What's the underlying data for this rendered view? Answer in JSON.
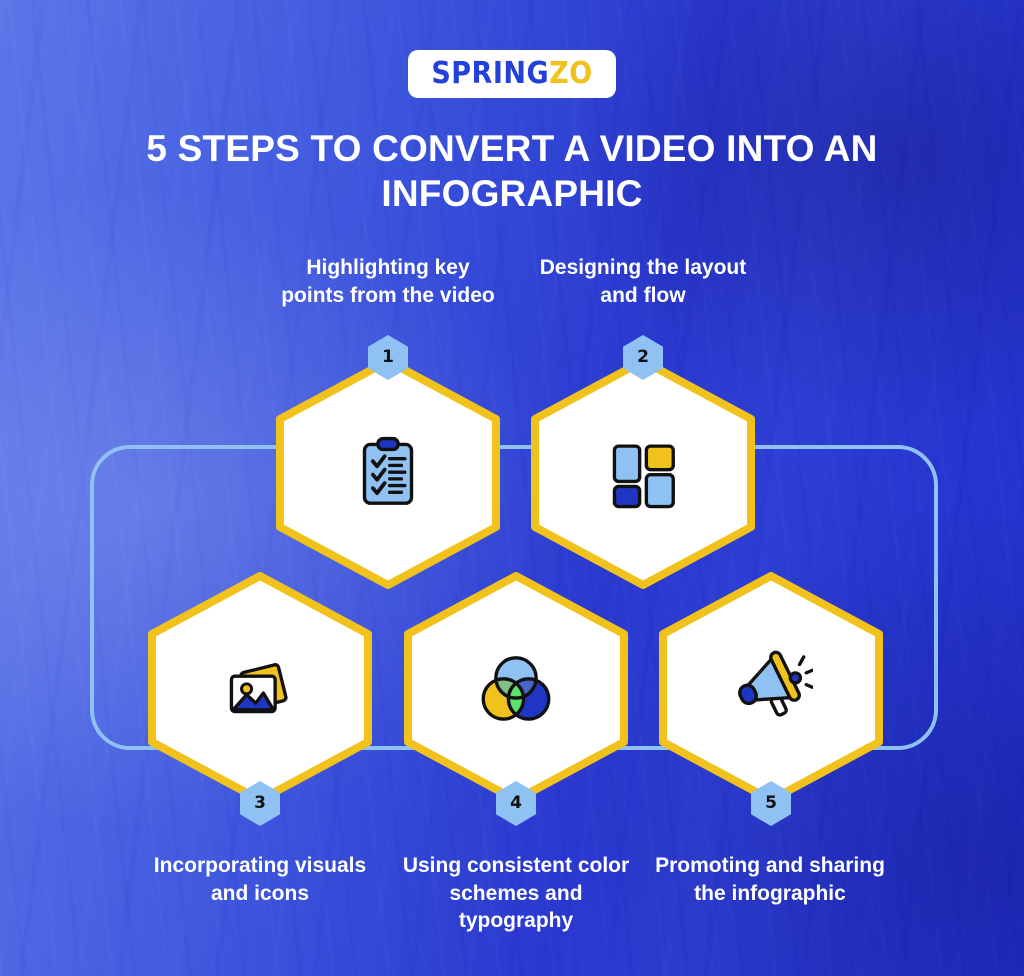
{
  "brand": {
    "logo_part1": "SPRING",
    "logo_part2": "ZO",
    "logo_blue": "#2341D8",
    "logo_yellow": "#F2C21C"
  },
  "header": {
    "title": "5 STEPS TO CONVERT A VIDEO INTO AN INFOGRAPHIC"
  },
  "theme": {
    "hex_border": "#F2C21C",
    "hex_fill": "#FFFFFF",
    "badge_fill": "#8FC2F2",
    "connector_stroke": "#8FC2F2",
    "background_blue_light": "#5C76E8",
    "background_blue_dark": "#2230CB",
    "caption_color": "#FFFFFF"
  },
  "steps": [
    {
      "number": "1",
      "caption": "Highlighting key points from the video",
      "icon": "clipboard-checklist-icon"
    },
    {
      "number": "2",
      "caption": "Designing the layout and flow",
      "icon": "layout-grid-icon"
    },
    {
      "number": "3",
      "caption": "Incorporating visuals and icons",
      "icon": "photo-stack-icon"
    },
    {
      "number": "4",
      "caption": "Using consistent color schemes and typography",
      "icon": "color-circles-icon"
    },
    {
      "number": "5",
      "caption": "Promoting and sharing the infographic",
      "icon": "megaphone-icon"
    }
  ]
}
